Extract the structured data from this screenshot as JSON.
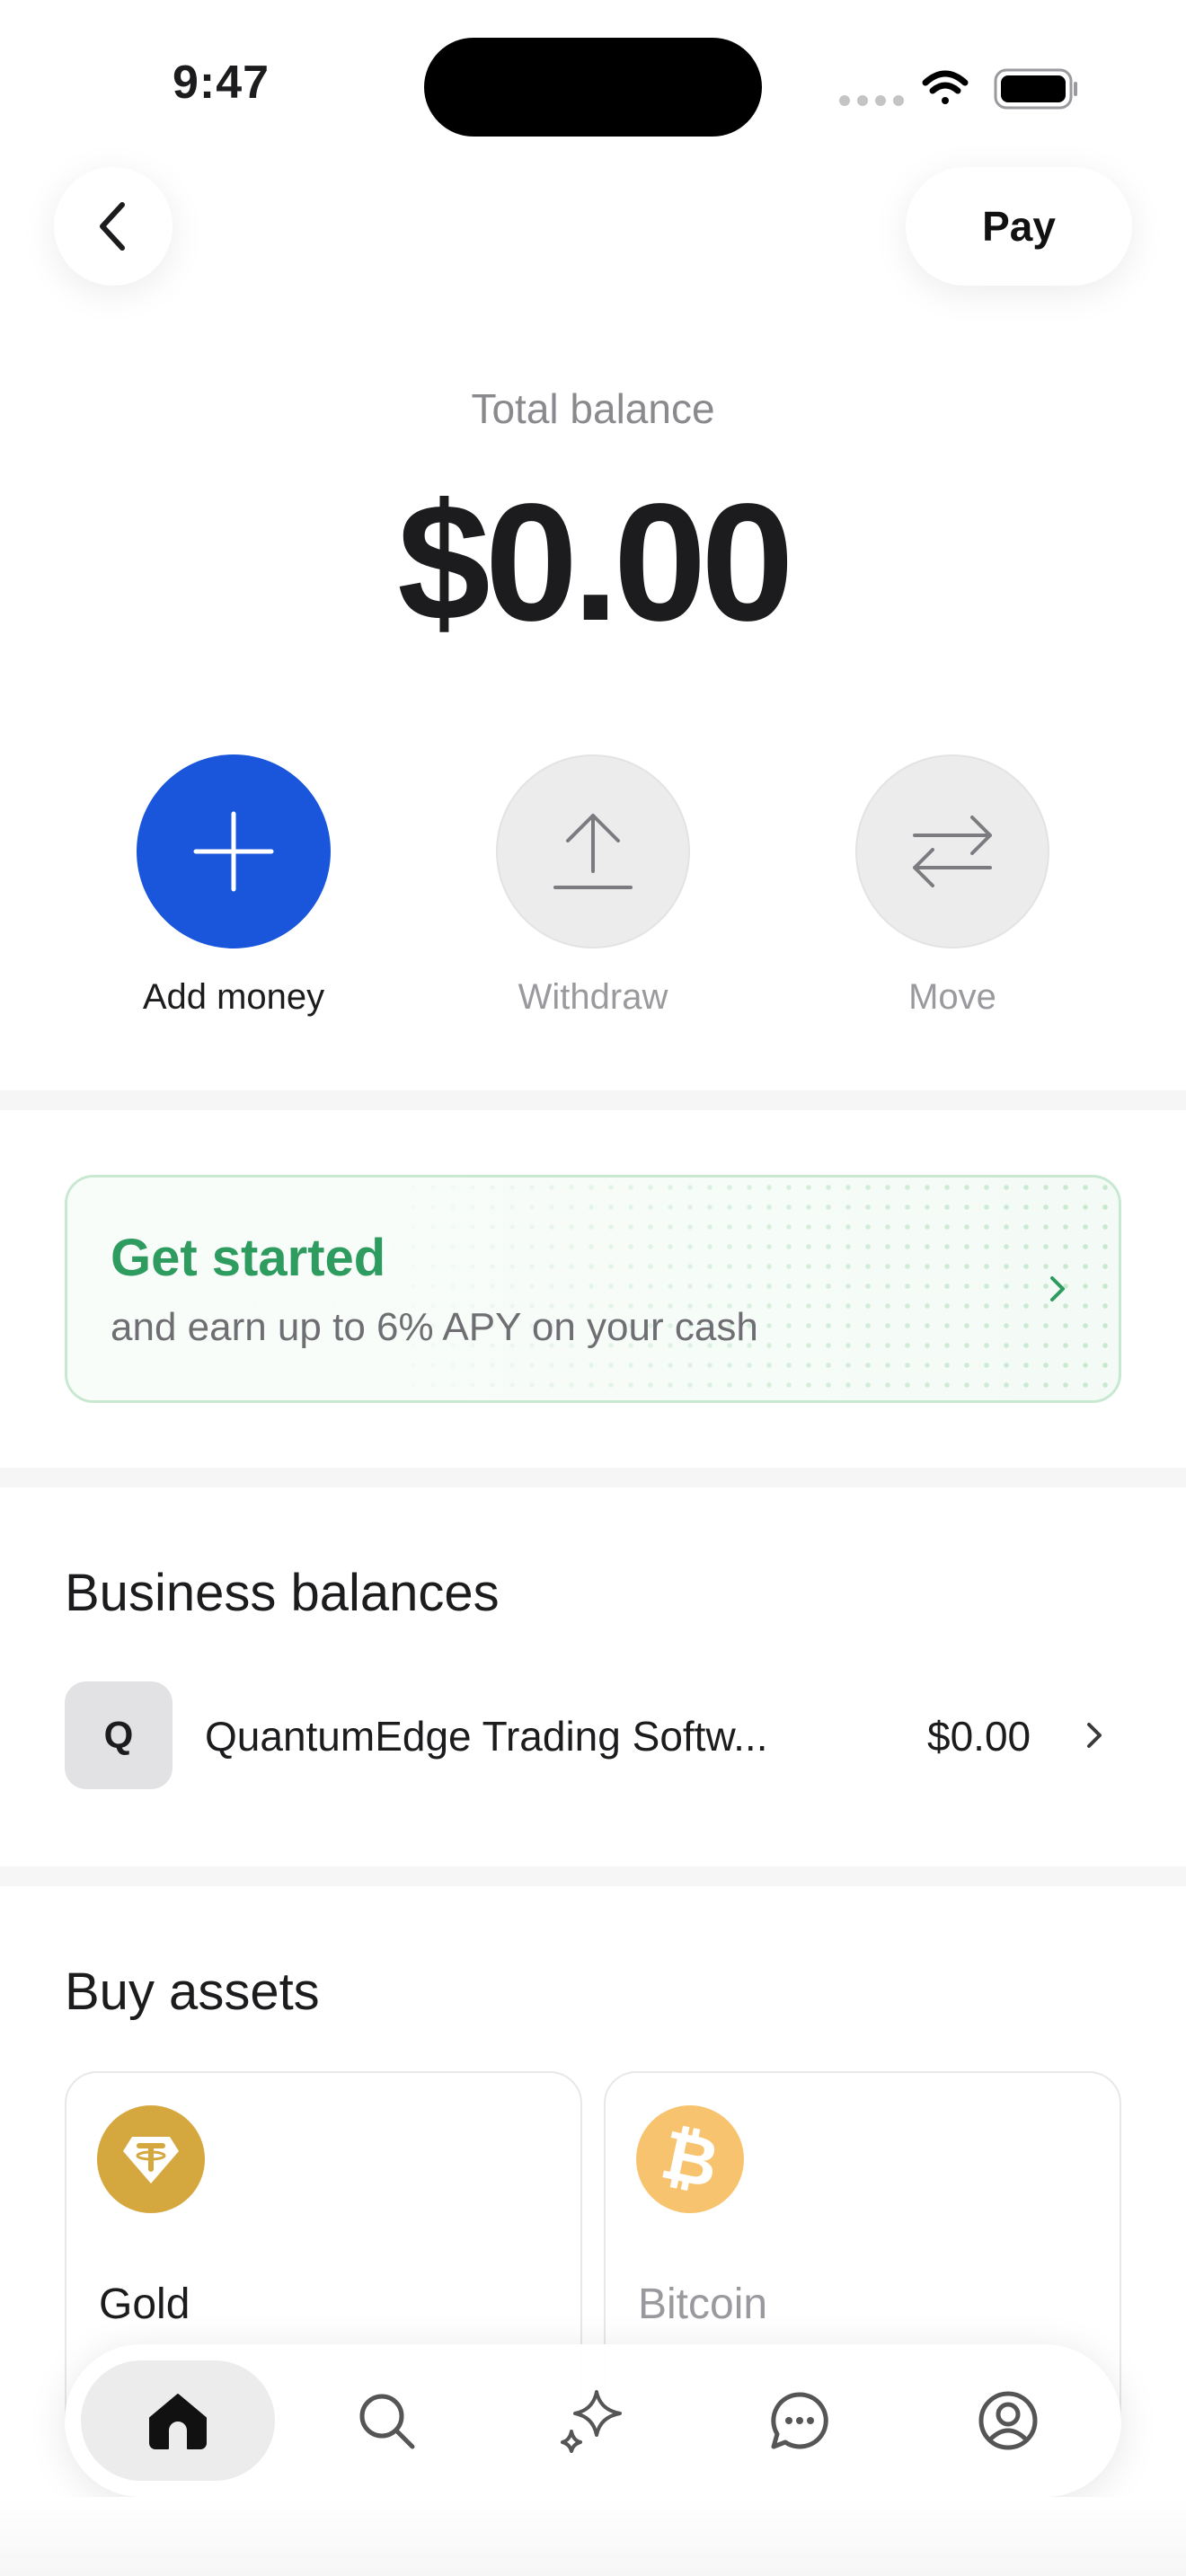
{
  "status_bar": {
    "time": "9:47"
  },
  "nav": {
    "pay_label": "Pay"
  },
  "balance": {
    "label": "Total balance",
    "value": "$0.00"
  },
  "actions": [
    {
      "label": "Add money",
      "icon": "plus-icon",
      "enabled": true
    },
    {
      "label": "Withdraw",
      "icon": "upload-arrow-icon",
      "enabled": false
    },
    {
      "label": "Move",
      "icon": "transfer-arrows-icon",
      "enabled": false
    }
  ],
  "promo": {
    "title": "Get started",
    "subtitle": "and earn up to 6% APY on your cash"
  },
  "business": {
    "title": "Business balances",
    "items": [
      {
        "initial": "Q",
        "name": "QuantumEdge Trading Softw...",
        "amount": "$0.00"
      }
    ]
  },
  "assets": {
    "title": "Buy assets",
    "items": [
      {
        "name": "Gold",
        "icon": "tether-gold-icon",
        "color": "#d4a83f"
      },
      {
        "name": "Bitcoin",
        "icon": "bitcoin-icon",
        "color": "#f7b955"
      }
    ]
  },
  "tabbar": {
    "active": "home",
    "tabs": [
      "home-icon",
      "search-icon",
      "sparkle-icon",
      "chat-icon",
      "profile-icon"
    ]
  },
  "colors": {
    "primary": "#1a56db",
    "promo_green": "#2e9b5f"
  }
}
